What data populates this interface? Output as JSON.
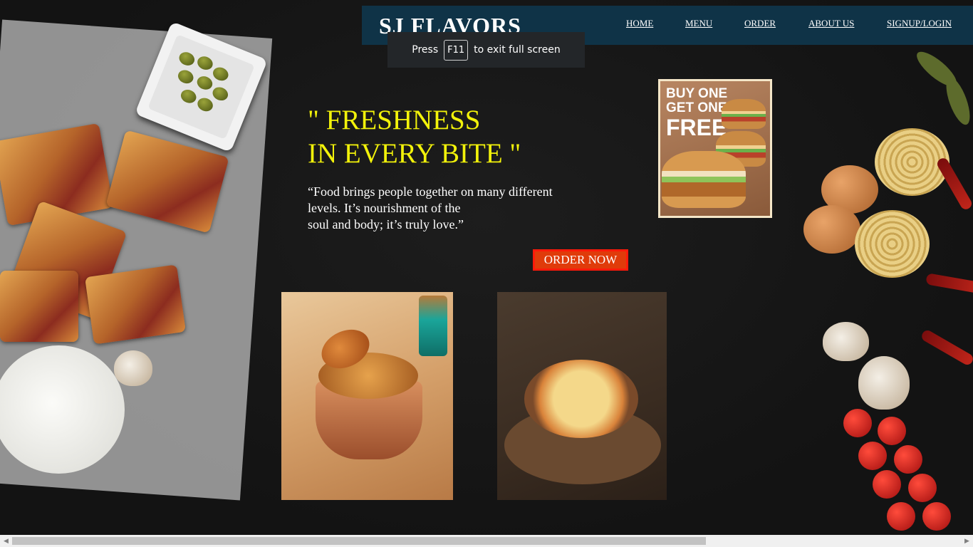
{
  "header": {
    "brand": "SJ FLAVORS",
    "nav": [
      "HOME",
      "MENU",
      "ORDER",
      "ABOUT US",
      "SIGNUP/LOGIN"
    ]
  },
  "fullscreen_toast": {
    "prefix": "Press",
    "key": "F11",
    "suffix": "to exit full screen"
  },
  "hero": {
    "headline_line1": "\" FRESHNESS",
    "headline_line2": "IN EVERY BITE \"",
    "quote_line1": "“Food brings people together on many different",
    "quote_line2": "levels. It’s nourishment of the",
    "quote_line3": "soul and body; it’s truly love.”",
    "order_button": "ORDER NOW"
  },
  "promo": {
    "line1": "BUY ONE",
    "line2": "GET ONE",
    "line3": "FREE"
  },
  "colors": {
    "navbar": "#0f3347",
    "headline": "#f2f20a",
    "order_button": "#e03b0a"
  },
  "icons": {
    "scroll_left": "arrow-left-icon",
    "scroll_right": "arrow-right-icon"
  }
}
